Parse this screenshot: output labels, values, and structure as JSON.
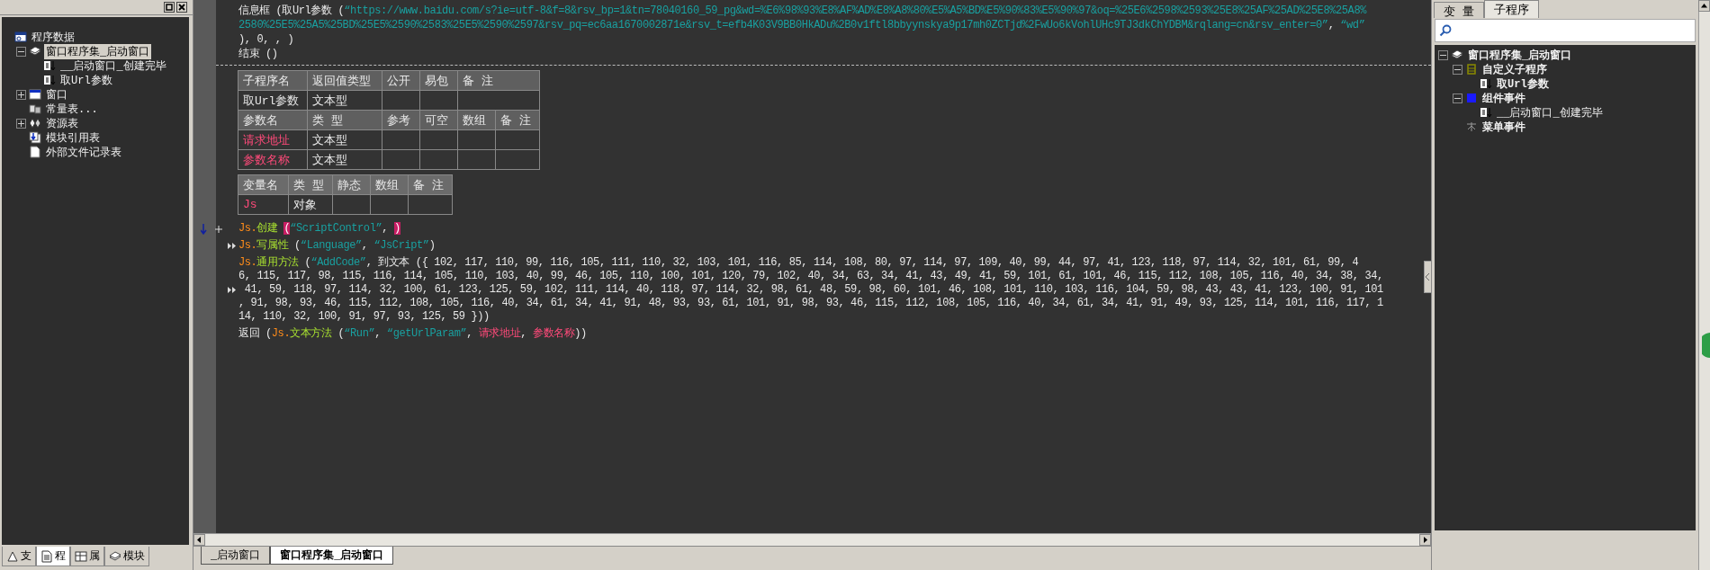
{
  "left_panel": {
    "tree": [
      {
        "label": "程序数据",
        "kind": "project",
        "selected": false,
        "children": [
          {
            "label": "窗口程序集_启动窗口",
            "kind": "module",
            "selected": true,
            "expanded": true,
            "children": [
              {
                "label": "__启动窗口_创建完毕",
                "kind": "sub",
                "selected": false
              },
              {
                "label": "取Url参数",
                "kind": "sub",
                "selected": false
              }
            ]
          },
          {
            "label": "窗口",
            "kind": "window",
            "selected": false,
            "expanded": false
          },
          {
            "label": "常量表...",
            "kind": "constants",
            "selected": false
          },
          {
            "label": "资源表",
            "kind": "resources",
            "selected": false,
            "expanded": false
          },
          {
            "label": "模块引用表",
            "kind": "module_ref",
            "selected": false
          },
          {
            "label": "外部文件记录表",
            "kind": "file",
            "selected": false
          }
        ]
      }
    ],
    "tabs": [
      {
        "label": "支",
        "kind": "support",
        "selected": false
      },
      {
        "label": "程",
        "kind": "program",
        "selected": true
      },
      {
        "label": "属",
        "kind": "property",
        "selected": false
      },
      {
        "label": "模块",
        "kind": "module",
        "selected": false
      }
    ]
  },
  "editor": {
    "header_lines": [
      [
        {
          "kind": "plain",
          "text": "信息框 (取Url参数 ("
        },
        {
          "kind": "string",
          "text": "“https://www.baidu.com/s?ie=utf-8&f=8&rsv_bp=1&tn=78040160_59_pg&wd=%E6%98%93%E8%AF%AD%E8%A8%80%E5%A5%BD%E5%90%83%E5%90%97&oq=%25E6%2598%2593%25E8%25AF%25AD%25E8%25A8%"
        }
      ],
      [
        {
          "kind": "string",
          "text": "2580%25E5%25A5%25BD%25E5%2590%2583%25E5%2590%2597&rsv_pq=ec6aa1670002871e&rsv_t=efb4K03V9BB0HkADu%2B0v1ftl8bbyynskya9p17mh0ZCTjd%2FwUo6kVohlUHc9TJ3dkChYDBM&rqlang=cn&rsv_enter=0”"
        },
        {
          "kind": "plain",
          "text": ", "
        },
        {
          "kind": "string",
          "text": "“wd”"
        }
      ],
      [
        {
          "kind": "plain",
          "text": "), 0, , )"
        }
      ],
      [
        {
          "kind": "plain",
          "text": "结束 ()"
        }
      ]
    ],
    "sub_table": {
      "columns": [
        "子程序名",
        "返回值类型",
        "公开",
        "易包",
        "备 注"
      ],
      "rows": [
        {
          "name": "取Url参数",
          "type": "文本型"
        }
      ]
    },
    "param_table": {
      "columns": [
        "参数名",
        "类 型",
        "参考",
        "可空",
        "数组",
        "备 注"
      ],
      "rows": [
        {
          "name": "请求地址",
          "type": "文本型"
        },
        {
          "name": "参数名称",
          "type": "文本型"
        }
      ]
    },
    "var_table": {
      "columns": [
        "变量名",
        "类 型",
        "静态",
        "数组",
        "备 注"
      ],
      "rows": [
        {
          "name": "Js",
          "type": "对象"
        }
      ]
    },
    "statements": [
      {
        "lines": [
          {
            "kind": "current",
            "segments": [
              {
                "kind": "object",
                "text": "Js."
              },
              {
                "kind": "method",
                "text": "创建 "
              },
              {
                "kind": "highlight",
                "text": "("
              },
              {
                "kind": "string",
                "text": "“ScriptControl”"
              },
              {
                "kind": "plain",
                "text": ", "
              },
              {
                "kind": "highlight",
                "text": ")"
              }
            ]
          }
        ]
      },
      {
        "lines": [
          {
            "kind": "fold",
            "segments": [
              {
                "kind": "object",
                "text": "Js."
              },
              {
                "kind": "method",
                "text": "写属性"
              },
              {
                "kind": "plain",
                "text": " ("
              },
              {
                "kind": "string",
                "text": "“Language”"
              },
              {
                "kind": "plain",
                "text": ", "
              },
              {
                "kind": "string",
                "text": "“JsCript”"
              },
              {
                "kind": "plain",
                "text": ")"
              }
            ]
          }
        ]
      },
      {
        "lines": [
          {
            "kind": "plain",
            "segments": [
              {
                "kind": "object",
                "text": "Js."
              },
              {
                "kind": "method",
                "text": "通用方法"
              },
              {
                "kind": "plain",
                "text": " ("
              },
              {
                "kind": "string",
                "text": "“AddCode”"
              },
              {
                "kind": "plain",
                "text": ", 到文本 ({ 102, 117, 110, 99, 116, 105, 111, 110, 32, 103, 101, 116, 85, 114, 108, 80, 97, 114, 97, 109, 40, 99, 44, 97, 41, 123, 118, 97, 114, 32, 101, 61, 99, 4"
              }
            ]
          },
          {
            "kind": "plain",
            "segments": [
              {
                "kind": "plain",
                "text": "6, 115, 117, 98, 115, 116, 114, 105, 110, 103, 40, 99, 46, 105, 110, 100, 101, 120, 79, 102, 40, 34, 63, 34, 41, 43, 49, 41, 59, 101, 61, 101, 46, 115, 112, 108, 105, 116, 40, 34, 38, 34,"
              }
            ]
          },
          {
            "kind": "fold",
            "segments": [
              {
                "kind": "plain",
                "text": " 41, 59, 118, 97, 114, 32, 100, 61, 123, 125, 59, 102, 111, 114, 40, 118, 97, 114, 32, 98, 61, 48, 59, 98, 60, 101, 46, 108, 101, 110, 103, 116, 104, 59, 98, 43, 43, 41, 123, 100, 91, 101"
              }
            ]
          },
          {
            "kind": "plain",
            "segments": [
              {
                "kind": "plain",
                "text": ", 91, 98, 93, 46, 115, 112, 108, 105, 116, 40, 34, 61, 34, 41, 91, 48, 93, 93, 61, 101, 91, 98, 93, 46, 115, 112, 108, 105, 116, 40, 34, 61, 34, 41, 91, 49, 93, 125, 114, 101, 116, 117, 1"
              }
            ]
          },
          {
            "kind": "plain",
            "segments": [
              {
                "kind": "plain",
                "text": "14, 110, 32, 100, 91, 97, 93, 125, 59 }))"
              }
            ]
          }
        ]
      },
      {
        "lines": [
          {
            "kind": "plain",
            "segments": [
              {
                "kind": "plain",
                "text": "返回 ("
              },
              {
                "kind": "object",
                "text": "Js."
              },
              {
                "kind": "method",
                "text": "文本方法"
              },
              {
                "kind": "plain",
                "text": " ("
              },
              {
                "kind": "string",
                "text": "“Run”"
              },
              {
                "kind": "plain",
                "text": ", "
              },
              {
                "kind": "string",
                "text": "“getUrlParam”"
              },
              {
                "kind": "plain",
                "text": ", "
              },
              {
                "kind": "variable",
                "text": "请求地址"
              },
              {
                "kind": "plain",
                "text": ", "
              },
              {
                "kind": "variable",
                "text": "参数名称"
              },
              {
                "kind": "plain",
                "text": "))"
              }
            ]
          }
        ]
      }
    ],
    "tabs": [
      {
        "label": "_启动窗口",
        "selected": false
      },
      {
        "label": "窗口程序集_启动窗口",
        "selected": true
      }
    ]
  },
  "right_panel": {
    "tabs": [
      {
        "label": "变 量",
        "selected": false
      },
      {
        "label": "子程序",
        "selected": true
      }
    ],
    "tree": [
      {
        "label": "窗口程序集_启动窗口",
        "kind": "module",
        "bold": true,
        "expanded": true,
        "children": [
          {
            "label": "自定义子程序",
            "kind": "custom",
            "bold": true,
            "expanded": true,
            "children": [
              {
                "label": "取Url参数",
                "kind": "sub",
                "bold": true
              }
            ]
          },
          {
            "label": "组件事件",
            "kind": "component",
            "bold": true,
            "expanded": true,
            "children": [
              {
                "label": "__启动窗口_创建完毕",
                "kind": "sub",
                "bold": false
              }
            ]
          },
          {
            "label": "菜单事件",
            "kind": "menu",
            "bold": true
          }
        ]
      }
    ]
  }
}
